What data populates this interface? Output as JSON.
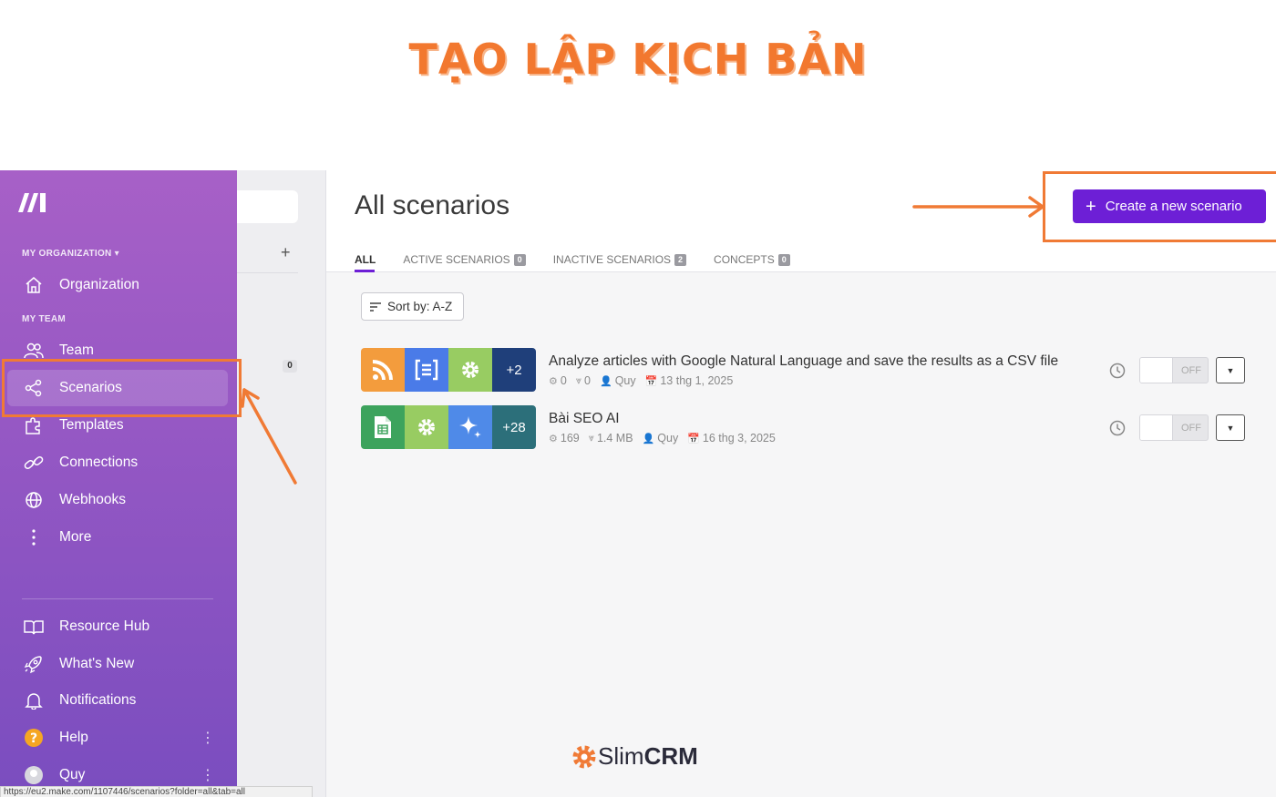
{
  "banner": {
    "title": "TẠO LẬP KỊCH BẢN"
  },
  "sidebar": {
    "org_section": "MY ORGANIZATION ▾",
    "team_section": "MY TEAM",
    "items": [
      {
        "label": "Organization",
        "icon": "home-icon"
      },
      {
        "label": "Team",
        "icon": "users-icon"
      },
      {
        "label": "Scenarios",
        "icon": "share-nodes-icon",
        "active": true
      },
      {
        "label": "Templates",
        "icon": "puzzle-icon"
      },
      {
        "label": "Connections",
        "icon": "link-icon"
      },
      {
        "label": "Webhooks",
        "icon": "globe-icon"
      },
      {
        "label": "More",
        "icon": "more-vertical-icon"
      }
    ],
    "bottom_items": [
      {
        "label": "Resource Hub",
        "icon": "book-icon"
      },
      {
        "label": "What's New",
        "icon": "rocket-icon"
      },
      {
        "label": "Notifications",
        "icon": "bell-icon"
      },
      {
        "label": "Help",
        "icon": "help-icon"
      },
      {
        "label": "Quy",
        "icon": "avatar-icon"
      }
    ]
  },
  "folders": {
    "count": "0"
  },
  "main": {
    "title": "All scenarios",
    "tabs": [
      {
        "label": "ALL",
        "count": ""
      },
      {
        "label": "ACTIVE SCENARIOS",
        "count": "0"
      },
      {
        "label": "INACTIVE SCENARIOS",
        "count": "2"
      },
      {
        "label": "CONCEPTS",
        "count": "0"
      }
    ],
    "create_label": "Create a new scenario",
    "sort_label": "Sort by: A-Z",
    "scenarios": [
      {
        "name": "Analyze articles with Google Natural Language and save the results as a CSV file",
        "ops": "0",
        "data": "0",
        "owner": "Quy",
        "date": "13 thg 1, 2025",
        "more_modules": "+2",
        "state": "OFF"
      },
      {
        "name": "Bài SEO AI",
        "ops": "169",
        "data": "1.4 MB",
        "owner": "Quy",
        "date": "16 thg 3, 2025",
        "more_modules": "+28",
        "state": "OFF"
      }
    ]
  },
  "brand": {
    "light": "Slim",
    "bold": "CRM"
  },
  "status_url": "https://eu2.make.com/1107446/scenarios?folder=all&tab=all",
  "colors": {
    "accent": "#6d1fd6",
    "annotation": "#f07a35",
    "sidebar_top": "#a760c7",
    "sidebar_bottom": "#7a4dbf"
  }
}
